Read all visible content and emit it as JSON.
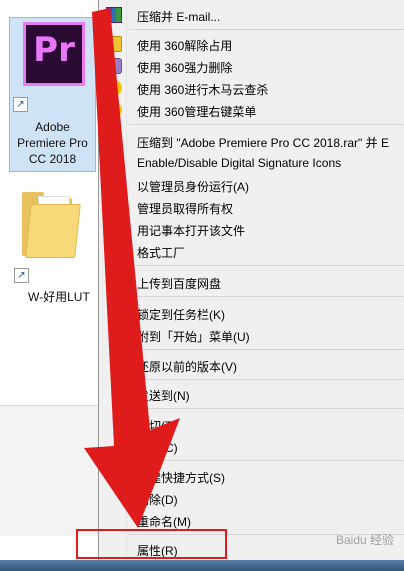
{
  "desktop": {
    "icons": [
      {
        "label_lines": [
          "Adobe",
          "Premiere Pro",
          "CC 2018"
        ],
        "logo_text": "Pr"
      },
      {
        "label": "W-好用LUT"
      }
    ]
  },
  "menu": {
    "items": [
      {
        "label": "压缩并 E-mail...",
        "icon": "winrar-icon"
      },
      {
        "label": "使用 360解除占用",
        "icon": "360-unlock-icon"
      },
      {
        "label": "使用 360强力删除",
        "icon": "360-delete-icon"
      },
      {
        "label": "使用 360进行木马云查杀",
        "icon": "360-scan-icon"
      },
      {
        "label": "使用 360管理右键菜单",
        "icon": "360-menu-icon"
      },
      {
        "label": "压缩到 \"Adobe Premiere Pro CC 2018.rar\" 并 E",
        "icon": "winrar-icon"
      },
      {
        "label": "Enable/Disable Digital Signature Icons",
        "icon": ""
      },
      {
        "label": "以管理员身份运行(A)",
        "icon": "uac-shield-icon"
      },
      {
        "label": "管理员取得所有权",
        "icon": ""
      },
      {
        "label": "用记事本打开该文件",
        "icon": ""
      },
      {
        "label": "格式工厂",
        "icon": "format-factory-icon"
      },
      {
        "label": "上传到百度网盘",
        "icon": "baidu-cloud-icon"
      },
      {
        "label": "锁定到任务栏(K)",
        "icon": ""
      },
      {
        "label": "附到「开始」菜单(U)",
        "icon": ""
      },
      {
        "label": "还原以前的版本(V)",
        "icon": ""
      },
      {
        "label": "发送到(N)",
        "icon": ""
      },
      {
        "label": "剪切(T)",
        "icon": ""
      },
      {
        "label": "复制(C)",
        "icon": ""
      },
      {
        "label": "创建快捷方式(S)",
        "icon": ""
      },
      {
        "label": "删除(D)",
        "icon": ""
      },
      {
        "label": "重命名(M)",
        "icon": ""
      },
      {
        "label": "属性(R)",
        "icon": ""
      }
    ]
  },
  "overlay": {
    "watermark": "Baidu 经验"
  }
}
